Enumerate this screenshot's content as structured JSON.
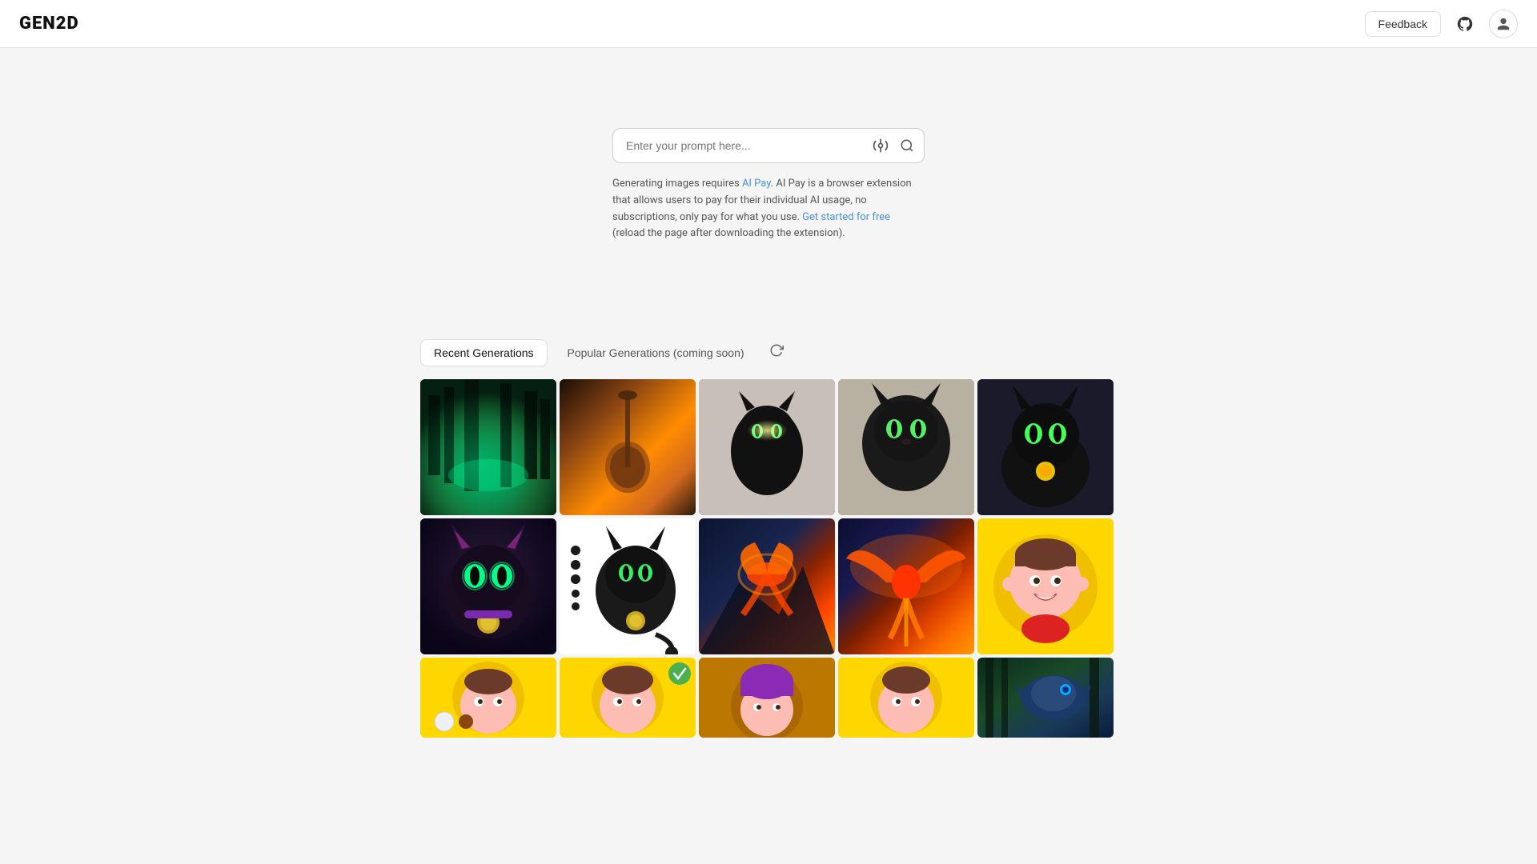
{
  "app": {
    "logo": "GEN2D"
  },
  "header": {
    "feedback_label": "Feedback",
    "github_icon": "github-icon",
    "user_icon": "user-icon"
  },
  "search": {
    "placeholder": "Enter your prompt here...",
    "adjust_icon": "adjust-icon",
    "search_icon": "search-icon"
  },
  "info": {
    "text_before_link1": "Generating images requires ",
    "link1_text": "AI Pay",
    "text_middle": ". AI Pay is a browser extension that allows users to pay for their individual AI usage, no subscriptions, only pay for what you use. ",
    "link2_text": "Get started for free",
    "text_after": " (reload the page after downloading the extension)."
  },
  "tabs": {
    "active": "Recent Generations",
    "inactive": "Popular Generations (coming soon)",
    "refresh_icon": "refresh-icon"
  },
  "gallery": {
    "row1": [
      {
        "id": "forest",
        "alt": "Fantasy forest scene with green glow"
      },
      {
        "id": "guitar",
        "alt": "Guitar at sunset in field"
      },
      {
        "id": "black-cat1",
        "alt": "Black cat sitting"
      },
      {
        "id": "black-cat2",
        "alt": "Black cat with green eyes close up"
      },
      {
        "id": "black-cat3",
        "alt": "Black cat with gold pendant"
      }
    ],
    "row2": [
      {
        "id": "cartoon-cat",
        "alt": "Cartoon black cat with glowing eyes"
      },
      {
        "id": "sketch-cat",
        "alt": "Sketch of black cat with coin pendant"
      },
      {
        "id": "phoenix1",
        "alt": "Phoenix flying over mountains"
      },
      {
        "id": "phoenix2",
        "alt": "Phoenix with fire wings at sunset"
      },
      {
        "id": "cartoon-char",
        "alt": "Cartoon character with brown hair on yellow"
      }
    ],
    "row3": [
      {
        "id": "char-bottom1",
        "alt": "Character portrait yellow background"
      },
      {
        "id": "char-bottom2",
        "alt": "Character portrait yellow background variant"
      },
      {
        "id": "char-bottom3",
        "alt": "Character with purple hair"
      },
      {
        "id": "char-bottom4",
        "alt": "Character portrait brown hair"
      },
      {
        "id": "dragon",
        "alt": "Blue dragon in forest"
      }
    ]
  }
}
